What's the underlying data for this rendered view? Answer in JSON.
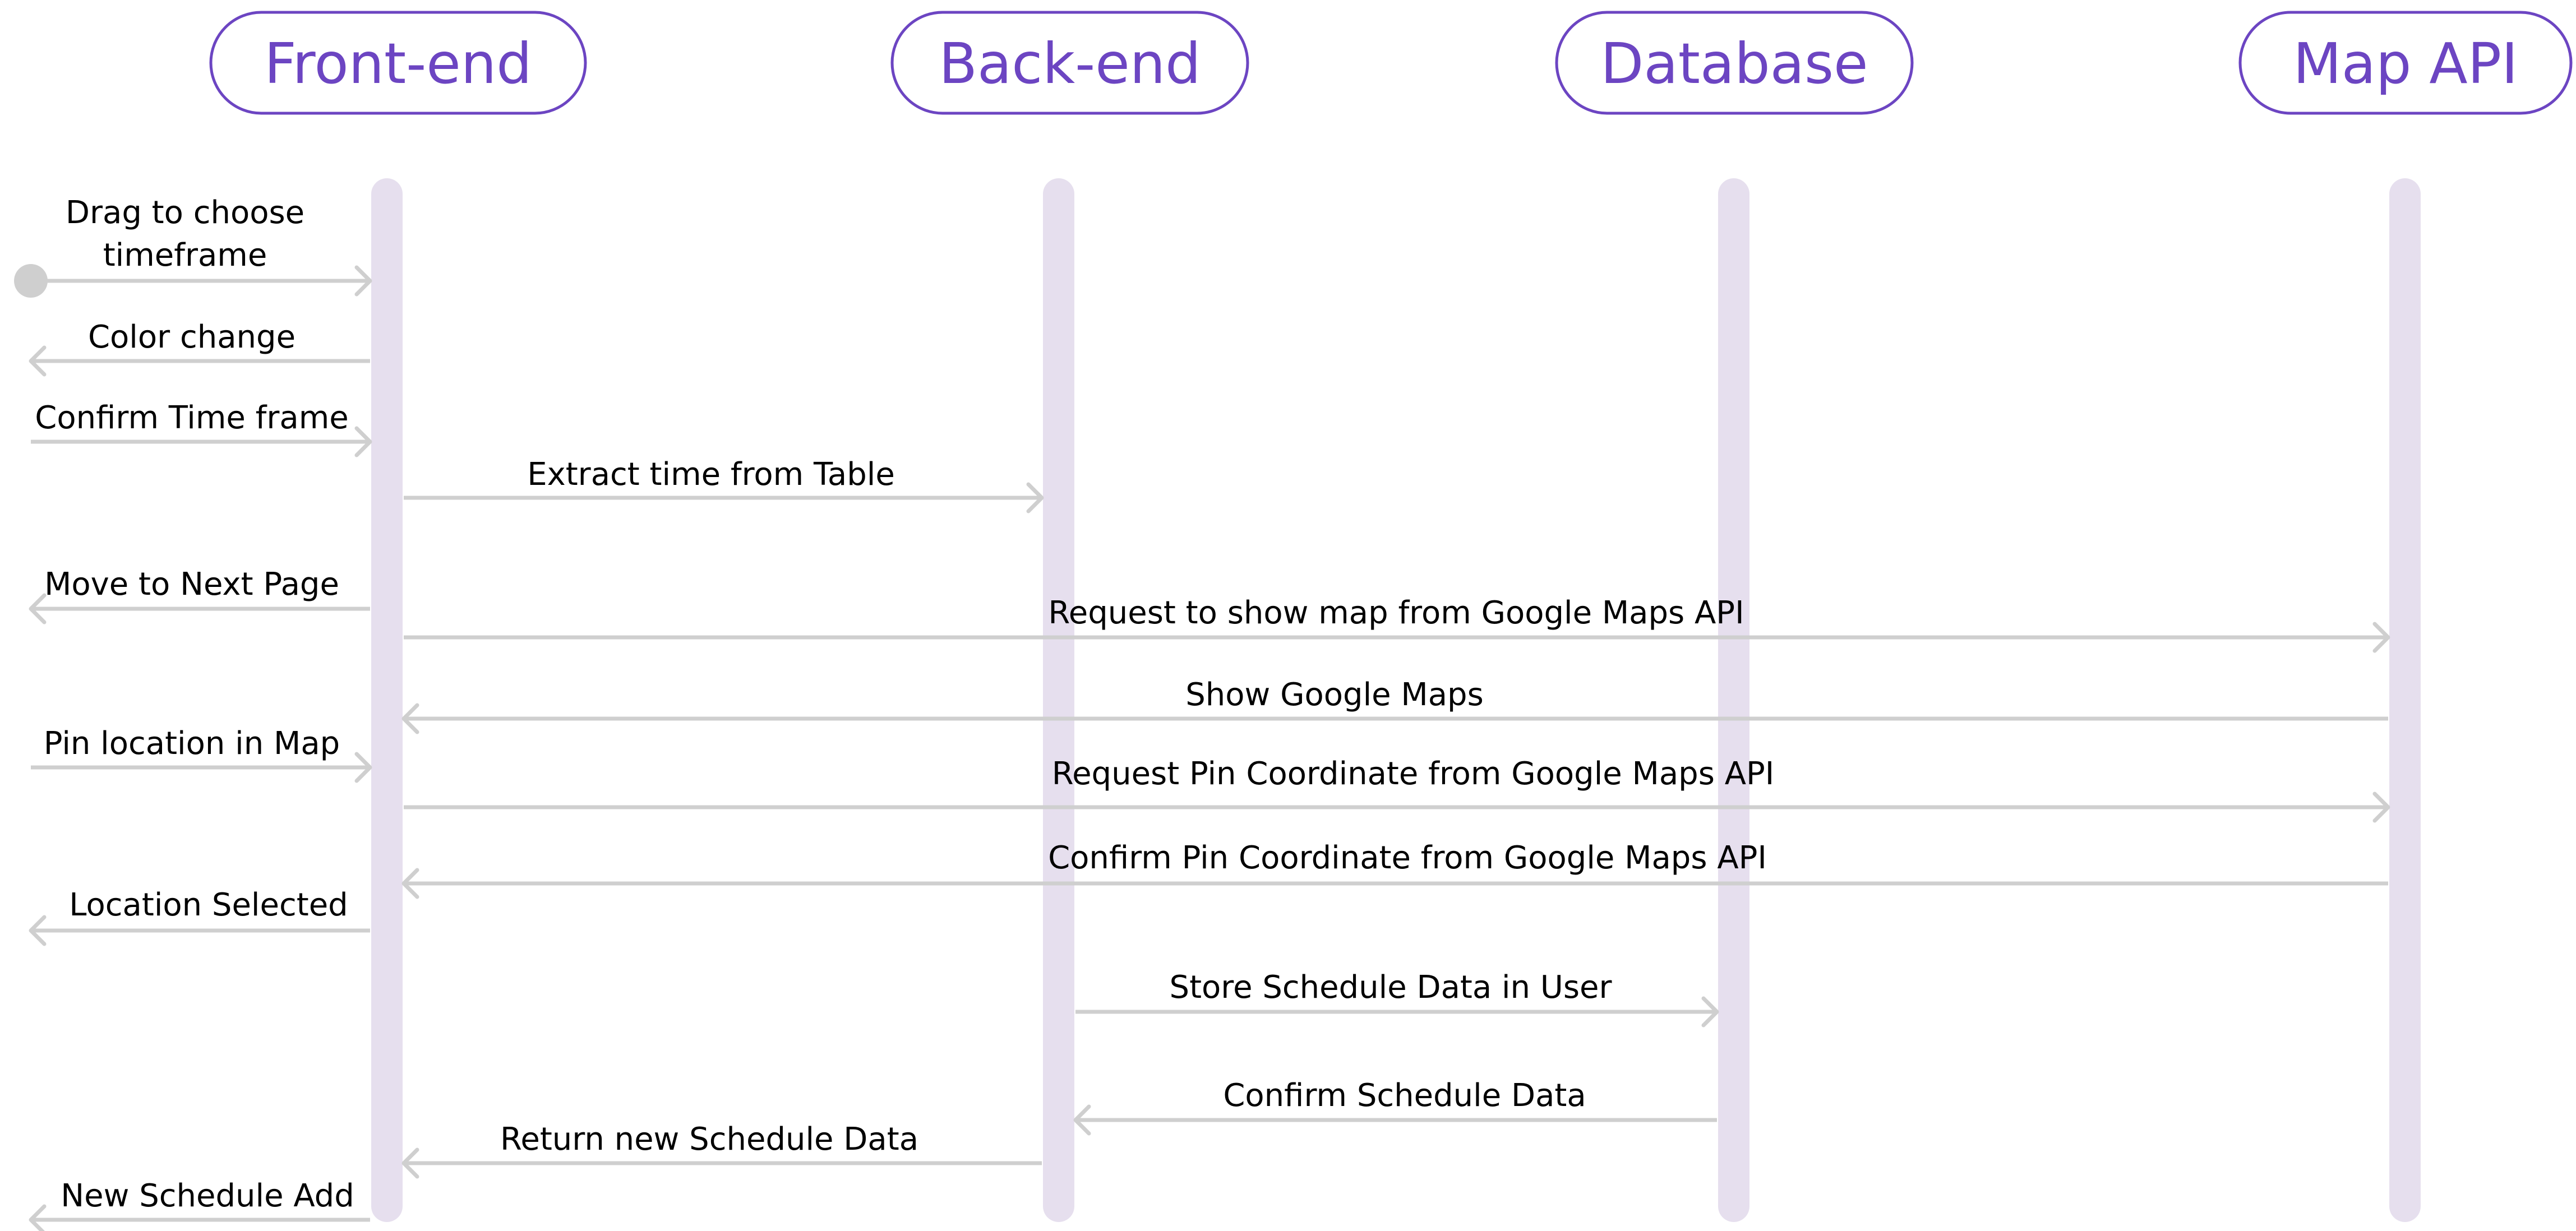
{
  "colors": {
    "actor_text": "#6c45c2",
    "actor_border": "#6c45c2",
    "lifeline": "#e6dfee",
    "arrow": "#cfcfcf",
    "start_dot": "#cfcfcf",
    "label_text": "#000000"
  },
  "participants": [
    {
      "id": "front-end",
      "label": "Front-end"
    },
    {
      "id": "back-end",
      "label": "Back-end"
    },
    {
      "id": "database",
      "label": "Database"
    },
    {
      "id": "map-api",
      "label": "Map API"
    }
  ],
  "messages": [
    {
      "label": "Drag to choose\ntimeframe",
      "from": "external",
      "to": "front-end",
      "kind": "start"
    },
    {
      "label": "Color change",
      "from": "front-end",
      "to": "external"
    },
    {
      "label": "Confirm Time frame",
      "from": "external",
      "to": "front-end"
    },
    {
      "label": "Extract time from Table",
      "from": "front-end",
      "to": "back-end"
    },
    {
      "label": "Move to Next Page",
      "from": "front-end",
      "to": "external"
    },
    {
      "label": "Request to show map from Google Maps API",
      "from": "front-end",
      "to": "map-api"
    },
    {
      "label": "Show Google Maps",
      "from": "map-api",
      "to": "front-end"
    },
    {
      "label": "Pin location in Map",
      "from": "external",
      "to": "front-end"
    },
    {
      "label": "Request Pin Coordinate from Google Maps API",
      "from": "front-end",
      "to": "map-api"
    },
    {
      "label": "Confirm Pin Coordinate from Google Maps API",
      "from": "map-api",
      "to": "front-end"
    },
    {
      "label": "Location Selected",
      "from": "front-end",
      "to": "external"
    },
    {
      "label": "Store Schedule Data in User",
      "from": "back-end",
      "to": "database"
    },
    {
      "label": "Confirm Schedule Data",
      "from": "database",
      "to": "back-end"
    },
    {
      "label": "Return new Schedule Data",
      "from": "back-end",
      "to": "front-end"
    },
    {
      "label": "New Schedule Add",
      "from": "front-end",
      "to": "external"
    }
  ]
}
